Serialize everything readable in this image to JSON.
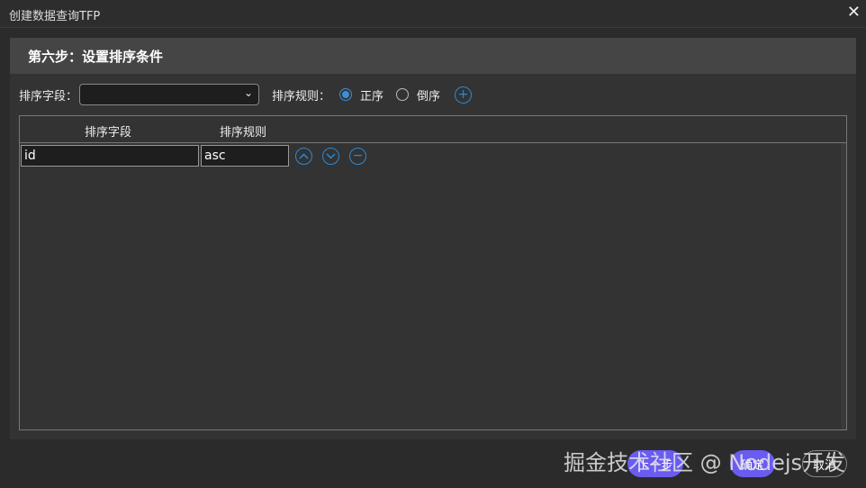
{
  "window": {
    "title": "创建数据查询TFP",
    "close": "✕"
  },
  "step": {
    "title": "第六步：设置排序条件"
  },
  "form": {
    "field_label": "排序字段：",
    "field_value": "",
    "chevron": "⌄",
    "rule_label": "排序规则：",
    "asc_label": "正序",
    "desc_label": "倒序",
    "selected": "asc",
    "add": "+"
  },
  "table": {
    "headers": [
      "排序字段",
      "排序规则"
    ],
    "rows": [
      {
        "field": "id",
        "rule": "asc"
      }
    ],
    "up": "^",
    "down": "v",
    "remove": "−"
  },
  "footer": {
    "prev": "上一步",
    "ok": "确定",
    "cancel": "取消"
  },
  "watermark": "掘金技术社区 @ Nodejs开发",
  "colors": {
    "accent": "#2a8ad6",
    "button": "#6a5cf0"
  }
}
